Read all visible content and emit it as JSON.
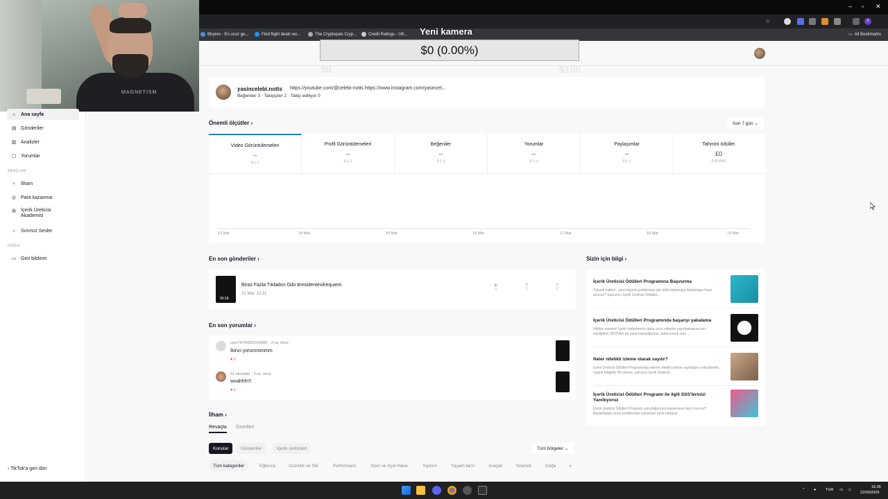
{
  "browser": {
    "bookmarks": [
      "Biryere - En ucuz ge...",
      "Find flight deals wo...",
      "The Cryptopals Cryp...",
      "Credit Ratings - UK..."
    ],
    "all_bookmarks": "All Bookmarks",
    "profile_letter": "Y"
  },
  "camera_overlay": {
    "title": "Yeni kamera",
    "value": "$0 (0.00%)",
    "ghost_left": "$0",
    "ghost_right": "$100"
  },
  "webcam": {
    "shirt_text": "MAGNETISM"
  },
  "sidebar": {
    "items": [
      {
        "label": "Ana sayfa",
        "icon": "home-icon"
      },
      {
        "label": "Gönderiler",
        "icon": "list-icon"
      },
      {
        "label": "Analizler",
        "icon": "chart-icon"
      },
      {
        "label": "Yorumlar",
        "icon": "comment-icon"
      }
    ],
    "section_tools": "ARAÇLAR",
    "tools": [
      {
        "label": "İlham",
        "icon": "bulb-icon"
      },
      {
        "label": "Para kazanma",
        "icon": "dollar-icon"
      },
      {
        "label": "İçerik Üreticisi Akademisi",
        "icon": "academy-icon"
      },
      {
        "label": "Sınırsız Sesler",
        "icon": "music-icon"
      }
    ],
    "section_other": "DİĞER",
    "other": [
      {
        "label": "Geri bildirim",
        "icon": "feedback-icon"
      }
    ],
    "back": "TikTok'a geri dön"
  },
  "profile": {
    "name": "yasincelebi.notts",
    "links": "https://youtube.com/@celebi-notts https://www.instagram.com/yasincel...",
    "stats": "Beğeniler 3 · Takipçiler 2 · Takip ediliyor 0"
  },
  "metrics": {
    "title": "Önemli ölçütler ›",
    "range": "Son 7 gün ⌄",
    "items": [
      {
        "label": "Video Görüntülemeleri",
        "value": "--",
        "sub": "0 (--)"
      },
      {
        "label": "Profil Görüntülemeleri",
        "value": "--",
        "sub": "0 (--)"
      },
      {
        "label": "Beğeniler",
        "value": "--",
        "sub": "0 (--)"
      },
      {
        "label": "Yorumlar",
        "value": "--",
        "sub": "0 (--)"
      },
      {
        "label": "Paylaşımlar",
        "value": "--",
        "sub": "0 (--)"
      },
      {
        "label": "Tahmini ödüller",
        "value": "£0",
        "sub": "0 (0.0%)"
      }
    ],
    "ticks": [
      "13 Mar",
      "14 Mar",
      "15 Mar",
      "16 Mar",
      "17 Mar",
      "18 Mar",
      "19 Mar"
    ]
  },
  "recent_posts": {
    "title": "En son gönderiler ›",
    "post": {
      "title": "Biraz Fazla Tıkladım Gibi #residentevilrequiem",
      "date": "22 Mar, 13:11",
      "duration": "00:18",
      "views": "5",
      "likes": "3",
      "comments": "2"
    }
  },
  "recent_comments": {
    "title": "En son yorumlar ›",
    "items": [
      {
        "meta": "user78743835315860 · 3 sa. önce",
        "text": "İkinci yorummmmm",
        "likes": "♥ 1"
      },
      {
        "meta": "01.dimolate · 3 sa. önce",
        "text": "woahhh!!!",
        "likes": "♥ 1"
      }
    ]
  },
  "inspiration": {
    "title": "İlham ›",
    "tabs": [
      "Revaçta",
      "Önerilen"
    ],
    "pills": [
      "Konular",
      "Gönderiler",
      "İçerik üreticileri"
    ],
    "region": "Tüm bölgeler ⌄",
    "categories": [
      "Tüm kategoriler",
      "Eğlence",
      "Güzellik ve Stil",
      "Performans",
      "Spor ve Açık Hava",
      "Toplum",
      "Yaşam tarzı",
      "Araçlar",
      "Yetenek",
      "Doğa"
    ],
    "next": "›"
  },
  "info": {
    "title": "Sizin için bilgi ›",
    "items": [
      {
        "title": "İçerik Üreticisi Ödülleri Programına Başvurma",
        "desc": "Yüksek kaliteli , uzun biçimli içeriklerinizi için ödül toplamaya başlamaya hazır mısınız? Şansınızı İçerik Üreticisi Ödülleri..."
      },
      {
        "title": "İçerik Üreticisi Ödülleri Programında başarıyı yakalama",
        "desc": "Hikâye zamanı! İçerik üreticilerinin daha uzun videolar yayınlamasına izin verdiğimiz 2022'den bu yana topluluğumuz, daha esnek olan ..."
      },
      {
        "title": "Neler nitelikli izleme olarak sayılır?",
        "desc": "İçerik Üreticisi Ödülleri Programında nelerin nitelikli izleme sayıldığını netleştirelim. Uygun bölgeler Bir izleme, yalnızca İçerik Üreticisi..."
      },
      {
        "title": "İçerik Üreticisi Ödülleri Programı ile ilgili SSS'lerinizi Yanıtlıyoruz",
        "desc": "İçerik Üreticisi Ödülleri Programı yolculuğunuza başlamaya hazır mısınız? Başlamadan önce kendinizden tamamen emin olmanız..."
      }
    ]
  },
  "taskbar": {
    "lang": "TUR",
    "time": "16:36",
    "date": "22/03/2026"
  }
}
